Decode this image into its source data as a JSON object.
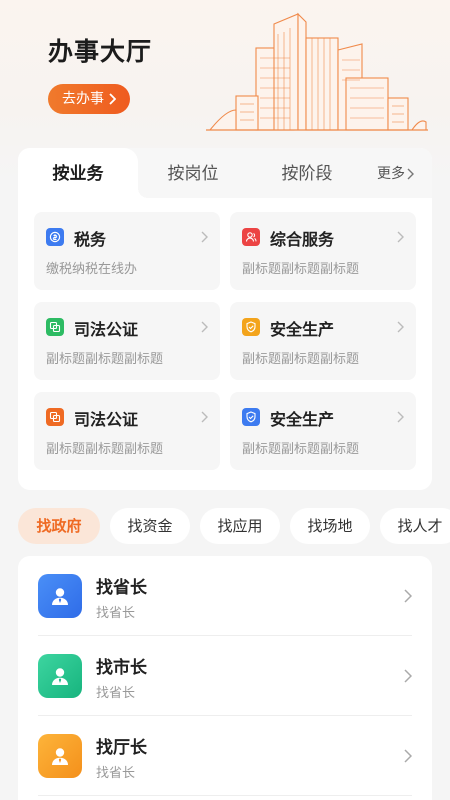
{
  "hero": {
    "title": "办事大厅",
    "button_label": "去办事"
  },
  "category_tabs": {
    "items": [
      "按业务",
      "按岗位",
      "按阶段"
    ],
    "active_index": 0,
    "more_label": "更多"
  },
  "services": [
    {
      "title": "税务",
      "subtitle": "缴税纳税在线办",
      "icon": "tax-icon",
      "color": "#3d7bf0"
    },
    {
      "title": "综合服务",
      "subtitle": "副标题副标题副标题",
      "icon": "people-icon",
      "color": "#ec4444"
    },
    {
      "title": "司法公证",
      "subtitle": "副标题副标题副标题",
      "icon": "notary-icon",
      "color": "#2dbb63"
    },
    {
      "title": "安全生产",
      "subtitle": "副标题副标题副标题",
      "icon": "shield-icon",
      "color": "#f3a41c"
    },
    {
      "title": "司法公证",
      "subtitle": "副标题副标题副标题",
      "icon": "notary-icon",
      "color": "#ef6a23"
    },
    {
      "title": "安全生产",
      "subtitle": "副标题副标题副标题",
      "icon": "shield-icon",
      "color": "#3d7bf0"
    }
  ],
  "find_chips": {
    "items": [
      "找政府",
      "找资金",
      "找应用",
      "找场地",
      "找人才"
    ],
    "active_index": 0
  },
  "officials": [
    {
      "title": "找省长",
      "subtitle": "找省长",
      "icon": "person-icon",
      "gradient": [
        "#4a8ff7",
        "#2f6ce8"
      ]
    },
    {
      "title": "找市长",
      "subtitle": "找省长",
      "icon": "person-icon",
      "gradient": [
        "#3dd5a0",
        "#17b47e"
      ]
    },
    {
      "title": "找厅长",
      "subtitle": "找省长",
      "icon": "person-icon",
      "gradient": [
        "#fdb43a",
        "#f4901b"
      ]
    }
  ],
  "colors": {
    "accent": "#ef6a23",
    "background": "#f5f5f5",
    "subtitle_text": "#999999"
  }
}
